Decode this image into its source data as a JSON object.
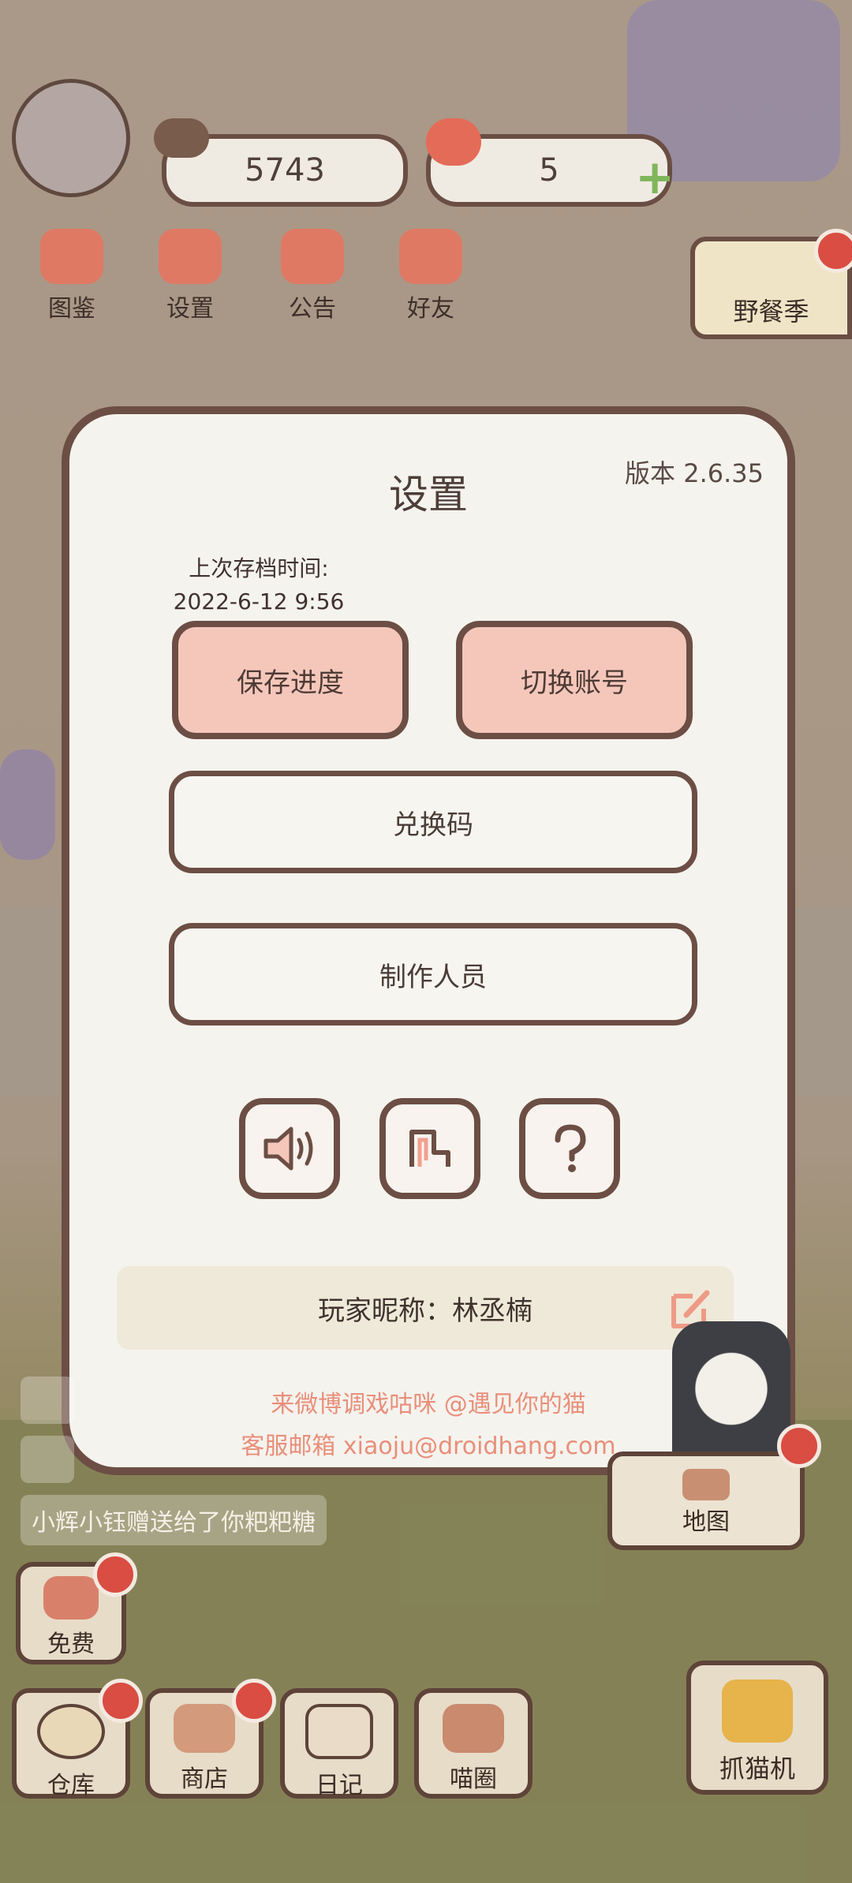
{
  "hud": {
    "coins": "5743",
    "hearts": "5",
    "menu": [
      {
        "label": "图鉴",
        "icon": "cat-head-icon"
      },
      {
        "label": "设置",
        "icon": "gear-icon"
      },
      {
        "label": "公告",
        "icon": "gift-icon"
      },
      {
        "label": "好友",
        "icon": "friends-icon"
      }
    ],
    "event_label": "野餐季"
  },
  "dialog": {
    "title": "设置",
    "version": "版本 2.6.35",
    "last_save_label": "上次存档时间:",
    "last_save_time": "2022-6-12 9:56",
    "save_button": "保存进度",
    "switch_account_button": "切换账号",
    "redeem_code_button": "兑换码",
    "credits_button": "制作人员",
    "icons": [
      "sound-icon",
      "music-icon",
      "help-icon"
    ],
    "nickname_label": "玩家昵称：林丞楠",
    "footer_line1": "来微博调戏咕咪 @遇见你的猫",
    "footer_line2": "客服邮箱 xiaoju@droidhang.com"
  },
  "chat": {
    "messages": [
      "小辉小钰赠送给了你粑粑糖"
    ]
  },
  "bottom": {
    "free": "免费",
    "warehouse": "仓库",
    "shop": "商店",
    "diary": "日记",
    "circle": "喵圈",
    "map": "地图",
    "claw": "抓猫机"
  },
  "colors": {
    "accent_pink": "#f5c7bb",
    "border_brown": "#6c4e44",
    "footer_text": "#e88f7a",
    "badge_red": "#d94d42"
  }
}
